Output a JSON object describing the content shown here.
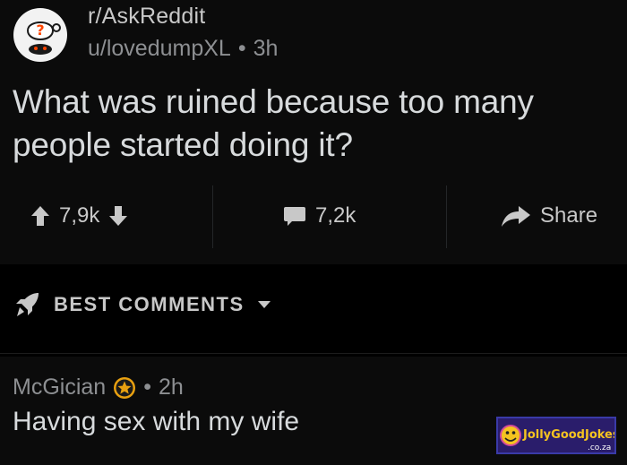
{
  "post": {
    "subreddit": "r/AskReddit",
    "author": "u/lovedumpXL",
    "separator": "•",
    "age": "3h",
    "title": "What was ruined because too many people started doing it?",
    "upvotes": "7,9k",
    "comments": "7,2k",
    "share_label": "Share"
  },
  "comments_section": {
    "sort_label": "BEST COMMENTS"
  },
  "top_comment": {
    "author": "McGician",
    "separator": "•",
    "age": "2h",
    "body": "Having sex with my wife"
  },
  "icons": {
    "subreddit_avatar": "askreddit-alien-icon",
    "upvote": "arrow-up-icon",
    "downvote": "arrow-down-icon",
    "comment": "speech-bubble-icon",
    "share": "share-arrow-icon",
    "sort": "rocket-icon",
    "dropdown": "caret-down-icon",
    "award": "star-award-icon"
  },
  "watermark": {
    "brand": "JollyGoodJokes",
    "domain": ".co.za"
  },
  "colors": {
    "background": "#000000",
    "card": "#0b0b0b",
    "text_primary": "#d7dadc",
    "text_muted": "#8d8f92",
    "award_gold": "#e8a010"
  }
}
